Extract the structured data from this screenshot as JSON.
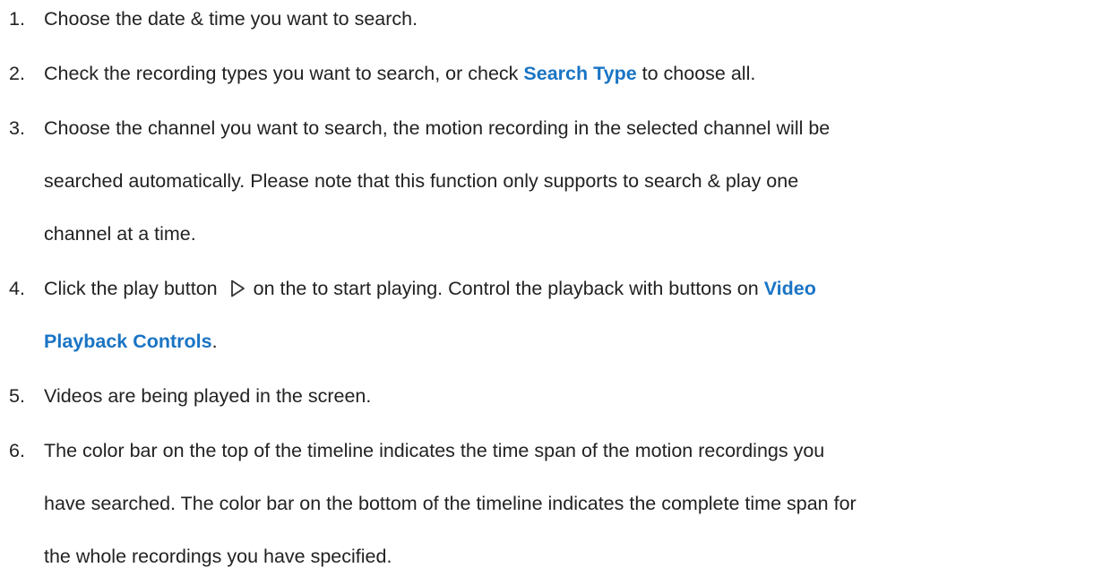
{
  "steps": [
    {
      "number": "1.",
      "lines": [
        "Choose the date & time you want to search."
      ]
    },
    {
      "number": "2.",
      "before": "Check the recording types you want to search, or check ",
      "link": "Search Type",
      "after": " to choose all."
    },
    {
      "number": "3.",
      "lines": [
        "Choose the channel you want to search, the motion recording in the selected channel will be",
        "searched automatically. Please note that this function only supports to search & play one",
        "channel at a time."
      ]
    },
    {
      "number": "4.",
      "before": "Click the play button",
      "after": "on the to start playing. Control the playback with buttons on ",
      "link_line1": "Video",
      "link_line2": "Playback Controls",
      "tail": "."
    },
    {
      "number": "5.",
      "lines": [
        "Videos are being played in the screen."
      ]
    },
    {
      "number": "6.",
      "lines": [
        "The color bar on the top of the timeline indicates the time span of the motion recordings you",
        "have searched. The color bar on the bottom of the timeline indicates the complete time span for",
        "the whole recordings you have specified."
      ]
    }
  ],
  "icons": {
    "play": "play-icon"
  },
  "colors": {
    "link": "#1a74c4",
    "text": "#222222"
  }
}
